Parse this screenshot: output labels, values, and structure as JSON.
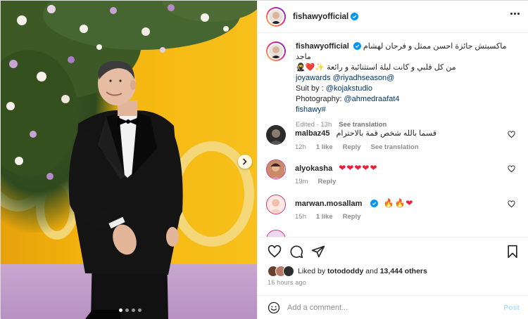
{
  "post": {
    "username": "fishawyofficial",
    "caption_line1": "ماكسبتش جائزة احسن ممثل و فرحان لهشام ماجد",
    "caption_line2": "من كل قلبي و كانت ليلة استثنائية و رائعة ✨❤️🥷",
    "mention_line": "joyawards @riyadhseason@",
    "suit_label": "Suit by : ",
    "suit_handle": "@kojakstudio",
    "photo_label": "Photography: ",
    "photo_handle": "@ahmedraafat4",
    "hashtag": "fishawy#",
    "edited": "Edited · 13h",
    "see_translation": "See translation"
  },
  "comments": [
    {
      "username": "malbaz45",
      "text": "قسما بالله شخص قمة بالاحترام",
      "time": "12h",
      "likes": "1 like",
      "reply": "Reply",
      "translation": "See translation"
    },
    {
      "username": "alyokasha",
      "text": "❤❤❤❤❤",
      "time": "19m",
      "reply": "Reply"
    },
    {
      "username": "marwan.mosallam",
      "text": "🔥🔥❤",
      "time": "15h",
      "likes": "1 like",
      "reply": "Reply"
    }
  ],
  "engagement": {
    "liked_by_prefix": "Liked by ",
    "liked_by_user": "totododdy",
    "liked_by_and": " and ",
    "liked_count": "13,444 others",
    "time_ago": "16 hours ago"
  },
  "comment_box": {
    "placeholder": "Add a comment...",
    "post_label": "Post"
  },
  "colors": {
    "verified": "#0095f6",
    "link": "#00376b",
    "heart": "#ed1d3a",
    "muted": "#8e8e8e"
  },
  "carousel": {
    "current_slide": 1,
    "total_slides": 4
  }
}
